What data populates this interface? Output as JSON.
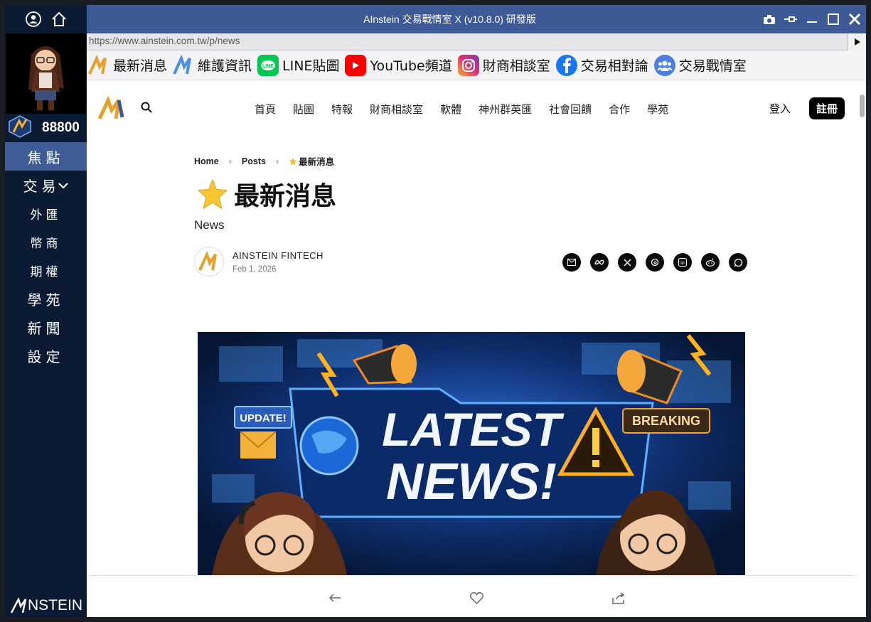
{
  "sidebar": {
    "points": "88800",
    "menu": [
      {
        "label": "焦點"
      },
      {
        "label": "交易"
      },
      {
        "label": "外匯"
      },
      {
        "label": "幣商"
      },
      {
        "label": "期權"
      },
      {
        "label": "學苑"
      },
      {
        "label": "新聞"
      },
      {
        "label": "設定"
      }
    ],
    "logo_text": "NSTEIN"
  },
  "window": {
    "title": "AInstein 交易戰情室 X (v10.8.0) 研發版"
  },
  "urlbar": {
    "url": "https://www.ainstein.com.tw/p/news"
  },
  "bookmarks": [
    {
      "label": "最新消息",
      "icon": "ainstein-logo-icon"
    },
    {
      "label": "維護資訊",
      "icon": "ainstein-logo-blue-icon"
    },
    {
      "label": "LINE貼圖",
      "icon": "line-icon"
    },
    {
      "label": "YouTube頻道",
      "icon": "youtube-icon"
    },
    {
      "label": "財商相談室",
      "icon": "instagram-icon"
    },
    {
      "label": "交易相對論",
      "icon": "facebook-icon"
    },
    {
      "label": "交易戰情室",
      "icon": "group-icon"
    }
  ],
  "site": {
    "nav": [
      "首頁",
      "貼圖",
      "特報",
      "財商相談室",
      "軟體",
      "神州群英匯",
      "社會回饋",
      "合作",
      "學苑"
    ],
    "login": "登入",
    "register": "註冊"
  },
  "article": {
    "breadcrumb": [
      "Home",
      "Posts",
      "最新消息"
    ],
    "title": "最新消息",
    "subtitle": "News",
    "author": "AINSTEIN FINTECH",
    "date": "Feb 1, 2026",
    "share_icons": [
      "email-icon",
      "meta-icon",
      "x-icon",
      "threads-icon",
      "linkedin-icon",
      "reddit-icon",
      "whatsapp-icon"
    ],
    "hero": {
      "headline_1": "LATEST",
      "headline_2": "NEWS!",
      "tag_left": "UPDATE!",
      "tag_right": "BREAKING"
    }
  },
  "colors": {
    "sidebar_bg": "#0b1b33",
    "titlebar_bg": "#3d5a96",
    "active_menu": "#3f5c97"
  }
}
